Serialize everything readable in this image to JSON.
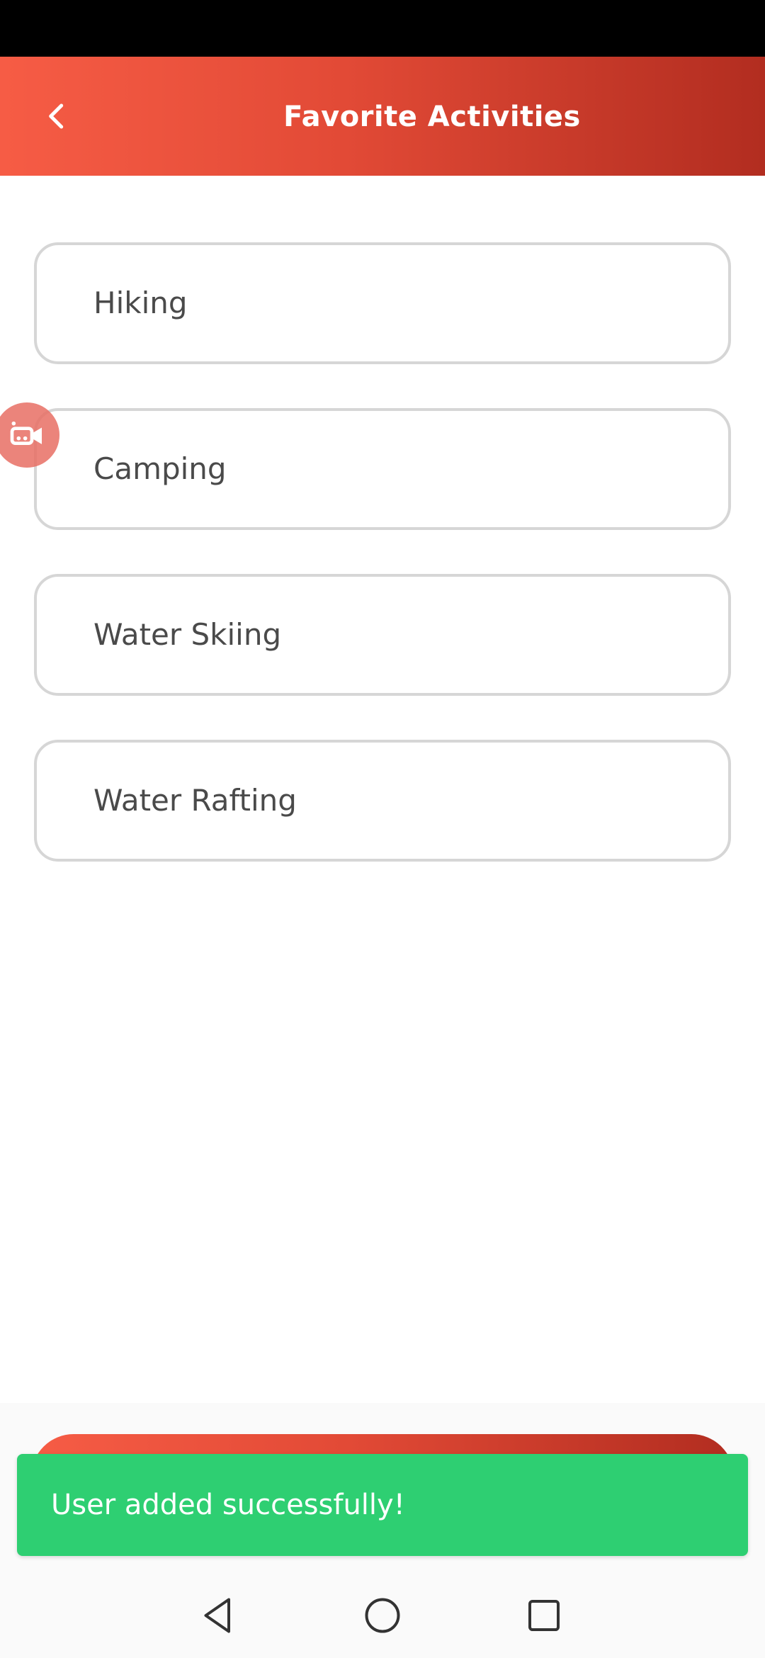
{
  "app_bar": {
    "title": "Favorite Activities",
    "back_icon": "chevron-left-icon"
  },
  "activities": [
    {
      "label": "Hiking"
    },
    {
      "label": "Camping"
    },
    {
      "label": "Water Skiing"
    },
    {
      "label": "Water Rafting"
    }
  ],
  "record_fab": {
    "icon": "video-camera-icon"
  },
  "snackbar": {
    "message": "User added successfully!"
  },
  "nav_bar": {
    "back_icon": "nav-back-icon",
    "home_icon": "nav-home-icon",
    "recents_icon": "nav-recents-icon"
  },
  "colors": {
    "accent_start": "#f65c45",
    "accent_end": "#b22d20",
    "snackbar": "#2ecf72",
    "item_border": "#d6d6d6",
    "item_text": "#4a4a4a"
  }
}
